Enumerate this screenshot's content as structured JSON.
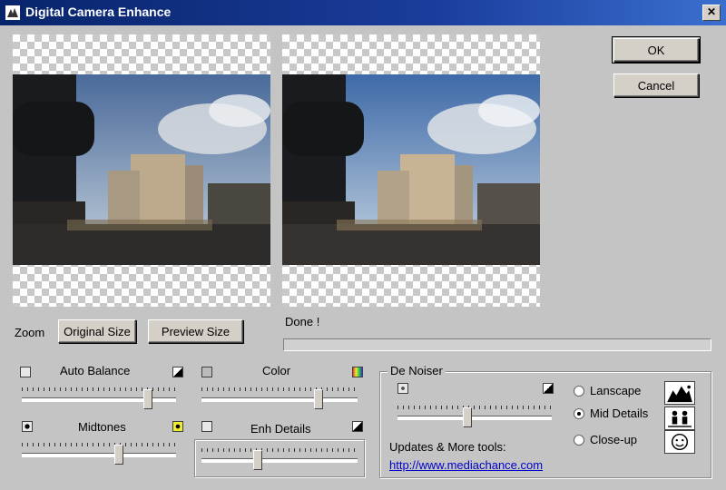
{
  "window": {
    "title": "Digital Camera Enhance",
    "close_glyph": "✕"
  },
  "buttons": {
    "ok": "OK",
    "cancel": "Cancel",
    "original_size": "Original Size",
    "preview_size": "Preview Size"
  },
  "zoom_label": "Zoom",
  "status": {
    "text": "Done !",
    "progress": 0
  },
  "sliders": {
    "auto_balance": {
      "label": "Auto Balance",
      "value": 0.82
    },
    "color": {
      "label": "Color",
      "value": 0.75
    },
    "midtones": {
      "label": "Midtones",
      "value": 0.63
    },
    "enh_details": {
      "label": "Enh Details",
      "value": 0.36
    },
    "denoiser": {
      "value": 0.45
    }
  },
  "denoiser": {
    "title": "De Noiser",
    "options": [
      {
        "label": "Lanscape",
        "checked": false,
        "icon": "landscape-icon"
      },
      {
        "label": "Mid Details",
        "checked": true,
        "icon": "people-icon"
      },
      {
        "label": "Close-up",
        "checked": false,
        "icon": "face-icon"
      }
    ],
    "updates_label": "Updates & More tools:",
    "link": "http://www.mediachance.com"
  },
  "colors": {
    "titlebar": "#08246b",
    "face": "#c4c4c4",
    "link": "#0000cc"
  }
}
